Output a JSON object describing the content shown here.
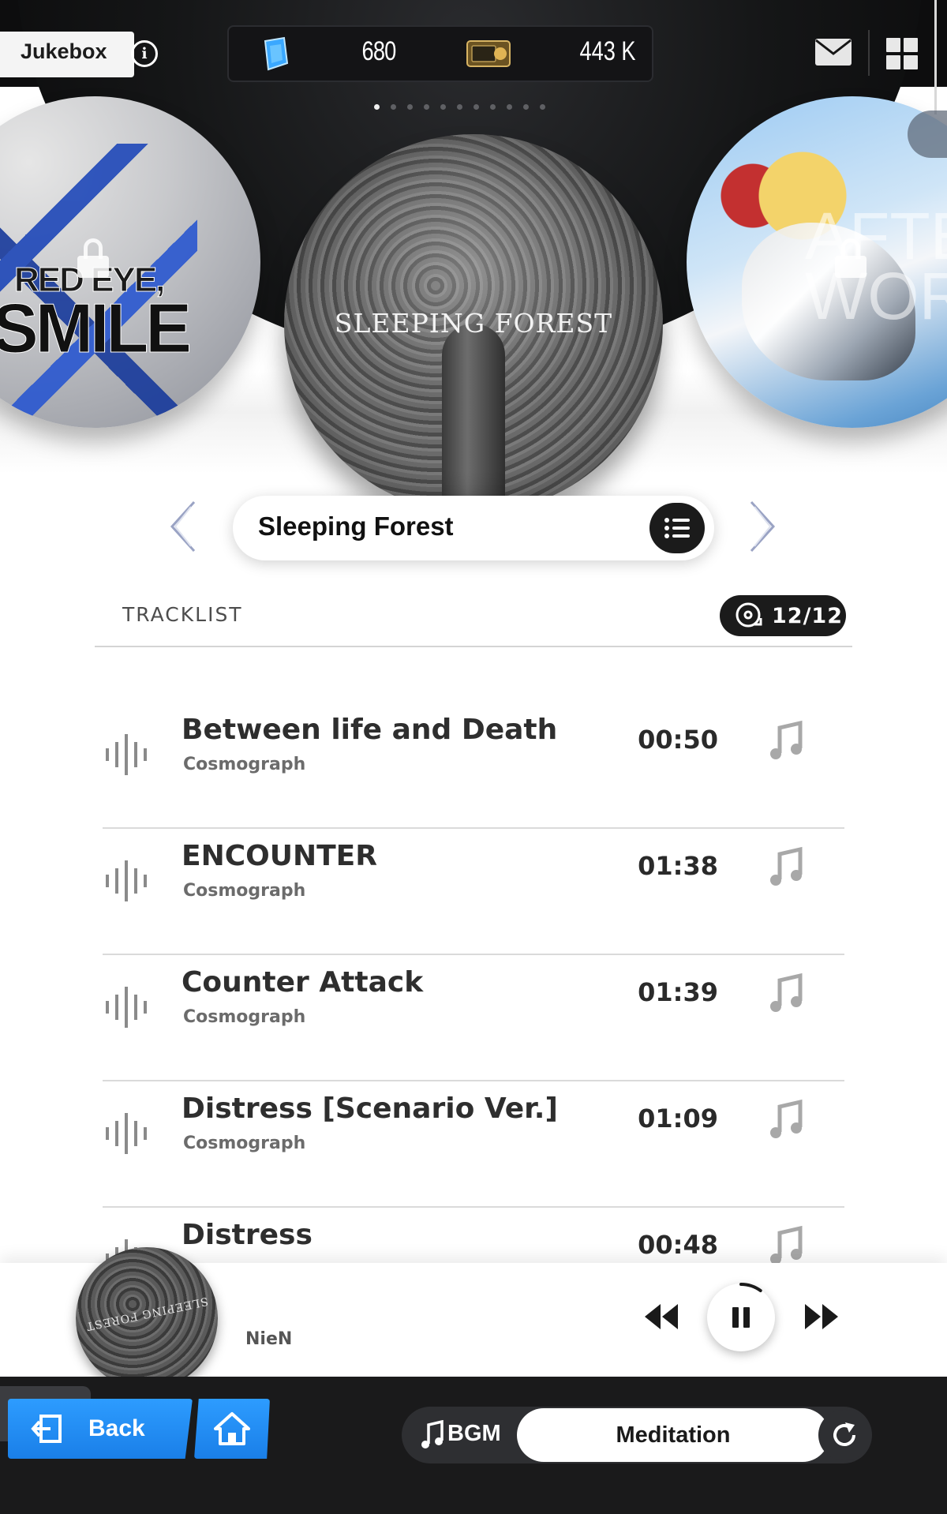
{
  "header": {
    "title": "Jukebox",
    "gems": "680",
    "credits": "443 K",
    "info_icon": "info-icon",
    "mail_icon": "mail-icon",
    "menu_icon": "grid-menu-icon"
  },
  "carousel": {
    "page_count": 11,
    "active_page": 1,
    "albums": [
      {
        "label_line1": "RED EYE,",
        "label_line2": "SMILE",
        "locked": true
      },
      {
        "label": "SLEEPING FOREST",
        "locked": false
      },
      {
        "label": "AFTER WORD",
        "locked": true
      }
    ]
  },
  "album_selector": {
    "current": "Sleeping Forest"
  },
  "tracklist": {
    "label": "TRACKLIST",
    "count": "12/12",
    "tracks": [
      {
        "title": "Between life and Death",
        "artist": "Cosmograph",
        "duration": "00:50"
      },
      {
        "title": "ENCOUNTER",
        "artist": "Cosmograph",
        "duration": "01:38"
      },
      {
        "title": "Counter Attack",
        "artist": "Cosmograph",
        "duration": "01:39"
      },
      {
        "title": "Distress [Scenario Ver.]",
        "artist": "Cosmograph",
        "duration": "01:09"
      },
      {
        "title": "Distress",
        "artist": "",
        "duration": "00:48"
      }
    ]
  },
  "player": {
    "disc_text": "SLEEPING FOREST",
    "artist": "NieN",
    "progress": 0.1
  },
  "bottom": {
    "back_label": "Back",
    "bgm_label": "BGM",
    "bgm_value": "Meditation"
  },
  "colors": {
    "accent_blue": "#1f8cf5",
    "dark": "#1b1b1b"
  }
}
